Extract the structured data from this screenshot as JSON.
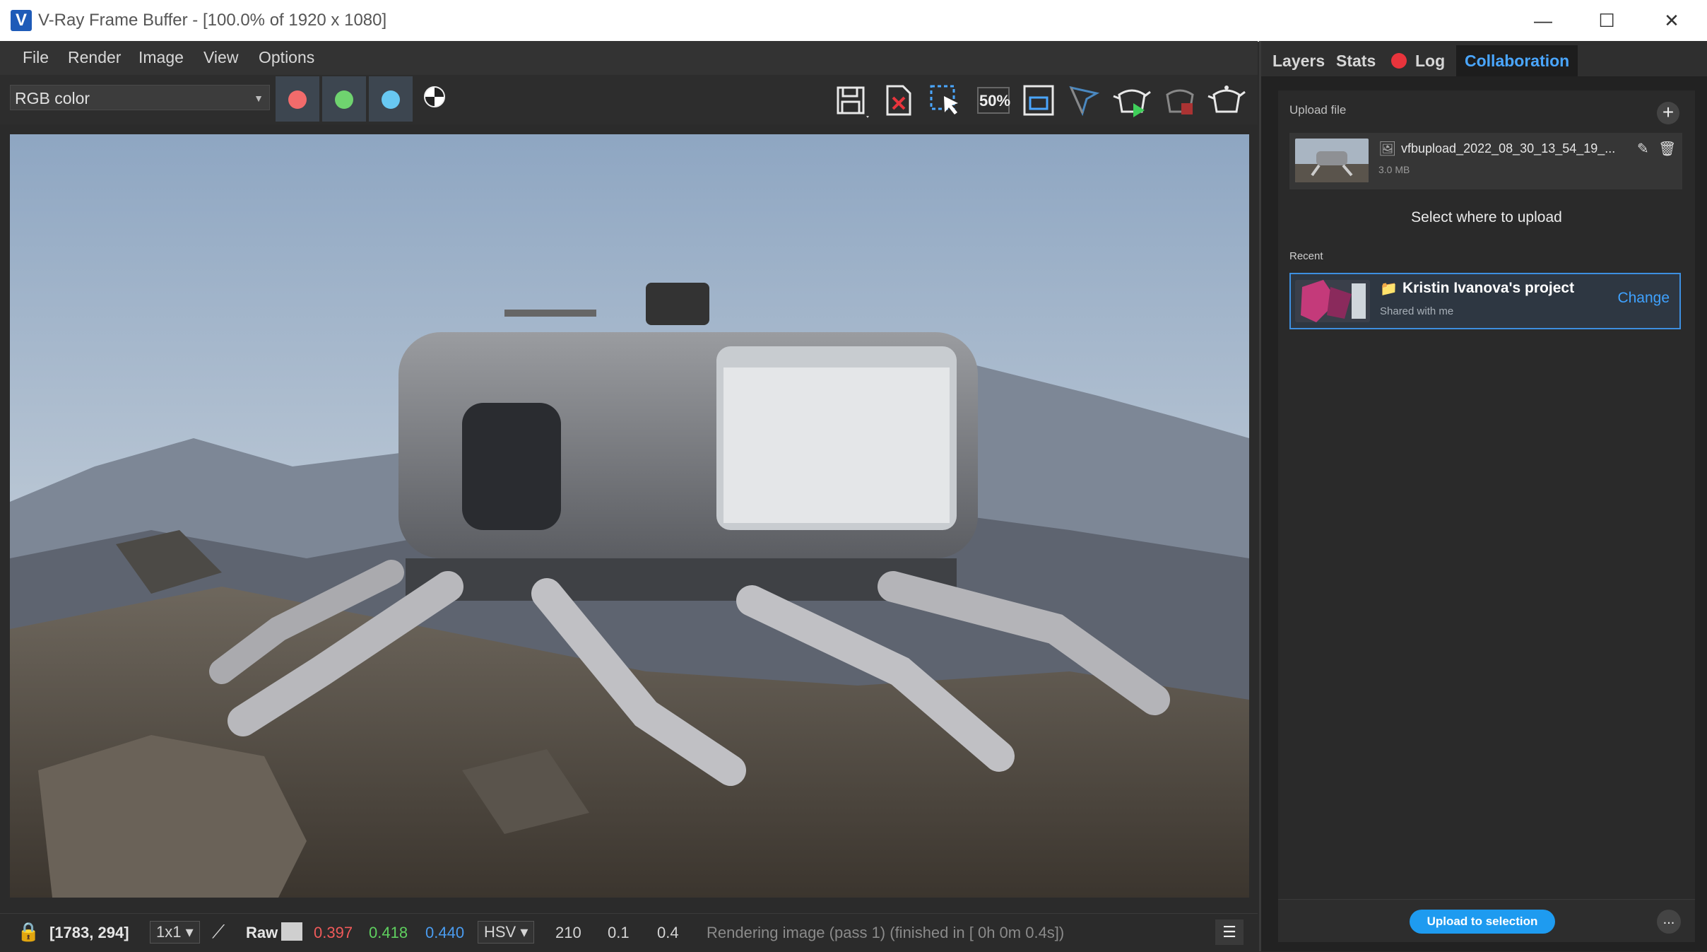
{
  "window": {
    "title": "V-Ray Frame Buffer - [100.0% of 1920 x 1080]",
    "logo": "V"
  },
  "menu": [
    "File",
    "Render",
    "Image",
    "View",
    "Options"
  ],
  "toolbar": {
    "channel": "RGB color",
    "channel_colors": {
      "red": "#f26b6b",
      "green": "#6fd36f",
      "blue": "#68c8f2"
    },
    "tools": [
      "save-icon",
      "clear-icon",
      "region-select-icon",
      "zoom-50-icon",
      "fit-icon",
      "track-mouse-icon",
      "render-start-icon",
      "render-stop-icon",
      "render-teapot-icon"
    ],
    "zoom_label": "50%"
  },
  "status": {
    "coords": "[1783, 294]",
    "sample": "1x1",
    "mode": "Raw",
    "r": "0.397",
    "g": "0.418",
    "b": "0.440",
    "colorspace": "HSV",
    "h": "210",
    "s": "0.1",
    "v": "0.4",
    "message": "Rendering image (pass 1) (finished in [ 0h  0m  0.4s])"
  },
  "right_tabs": [
    "Layers",
    "Stats",
    "Log",
    "Collaboration"
  ],
  "collab": {
    "upload_label": "Upload file",
    "file_name": "vfbupload_2022_08_30_13_54_19_...",
    "file_size": "3.0 MB",
    "select_where": "Select where to upload",
    "recent_label": "Recent",
    "project_name": "Kristin Ivanova's project",
    "project_sub": "Shared with me",
    "change": "Change",
    "upload_button": "Upload to selection",
    "more": "..."
  },
  "colors": {
    "accent": "#1e9bf0",
    "tab_active": "#4aa6ff",
    "log_dot": "#e8343c"
  }
}
